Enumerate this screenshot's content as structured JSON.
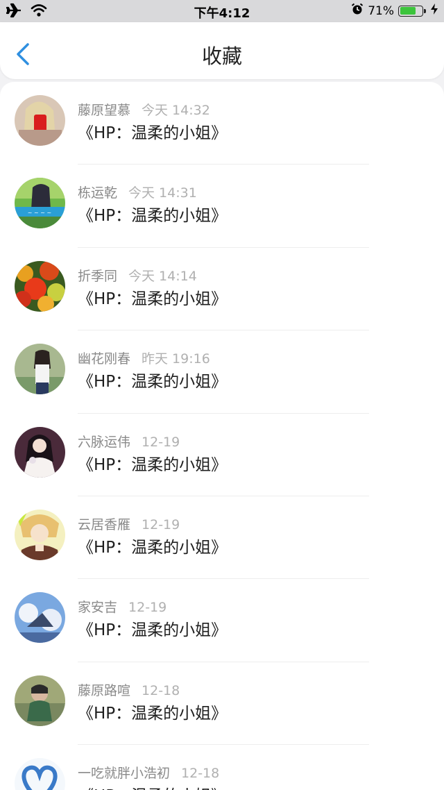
{
  "status_bar": {
    "time": "下午4:12",
    "battery_percent": "71%",
    "battery_level": 0.71,
    "icons": [
      "airplane-icon",
      "wifi-icon",
      "alarm-icon",
      "battery-icon",
      "charging-icon"
    ]
  },
  "nav": {
    "title": "收藏",
    "back_icon": "chevron-left-icon"
  },
  "colors": {
    "accent": "#2f8fe0",
    "title_text": "#1e1e1e",
    "meta_text": "#8a8a8a",
    "time_text": "#b0b0b0",
    "battery": "#3cc43c"
  },
  "favorites": [
    {
      "name": "藤原望慕",
      "time": "今天 14:32",
      "title": "《HP：温柔的小姐》",
      "avatar": "avatar-girl-red-phone"
    },
    {
      "name": "栋运乾",
      "time": "今天 14:31",
      "title": "《HP：温柔的小姐》",
      "avatar": "avatar-girl-green-caption"
    },
    {
      "name": "折季同",
      "time": "今天 14:14",
      "title": "《HP：温柔的小姐》",
      "avatar": "avatar-autumn-leaves"
    },
    {
      "name": "幽花刚春",
      "time": "昨天 19:16",
      "title": "《HP：温柔的小姐》",
      "avatar": "avatar-girl-outdoor"
    },
    {
      "name": "六脉运伟",
      "time": "12-19",
      "title": "《HP：温柔的小姐》",
      "avatar": "avatar-girl-white-dress"
    },
    {
      "name": "云居香雁",
      "time": "12-19",
      "title": "《HP：温柔的小姐》",
      "avatar": "avatar-anime-boy"
    },
    {
      "name": "家安吉",
      "time": "12-19",
      "title": "《HP：温柔的小姐》",
      "avatar": "avatar-anime-sky"
    },
    {
      "name": "藤原路喧",
      "time": "12-18",
      "title": "《HP：温柔的小姐》",
      "avatar": "avatar-child-green"
    },
    {
      "name": "一吃就胖小浩初",
      "time": "12-18",
      "title": "《HP：温柔的小姐》",
      "avatar": "avatar-blue-heart"
    }
  ]
}
